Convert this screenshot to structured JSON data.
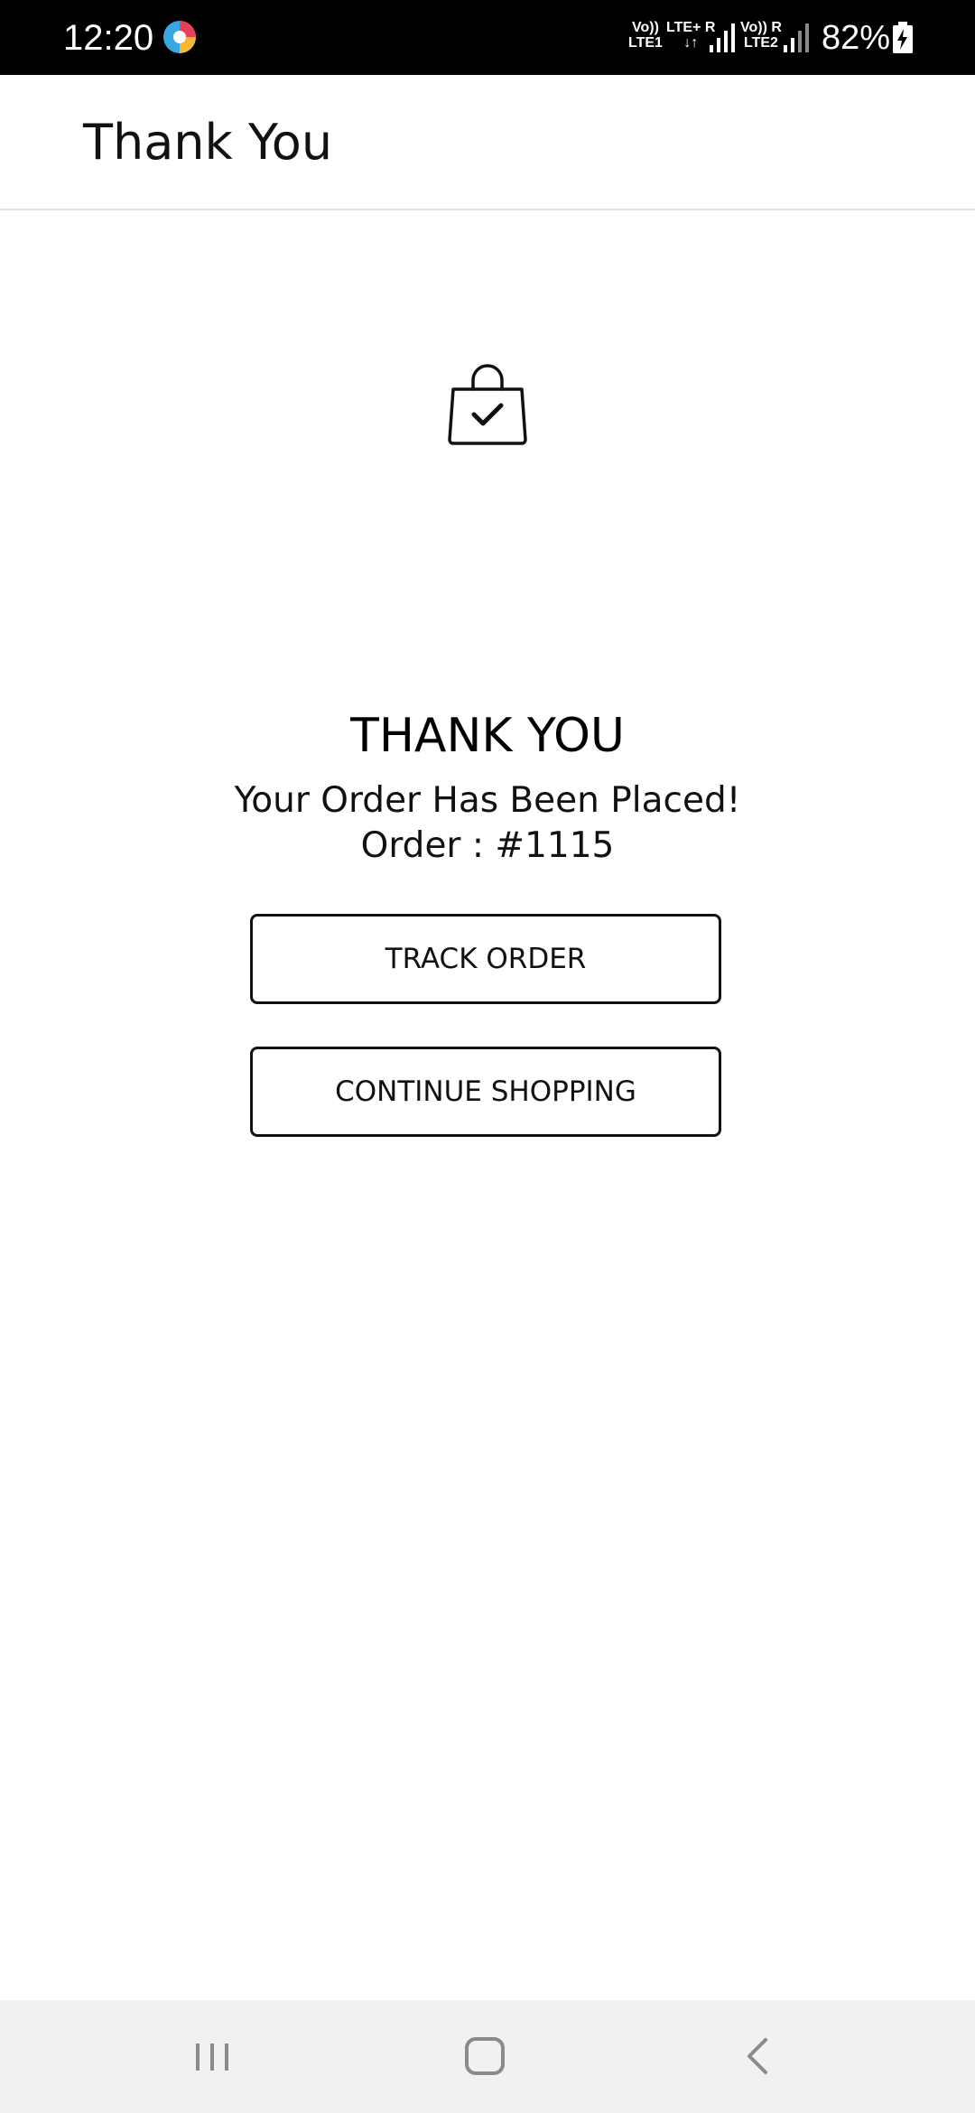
{
  "status_bar": {
    "time": "12:20",
    "sim1_top": "Vo))",
    "sim1_bottom": "LTE1",
    "sim1_net_top": "LTE+ R",
    "sim1_net_bottom": "↓↑",
    "sim2_top": "Vo)) R",
    "sim2_bottom": "LTE2",
    "battery": "82%"
  },
  "app_bar": {
    "title": "Thank You"
  },
  "confirmation": {
    "heading": "THANK YOU",
    "message": "Your Order Has Been Placed!",
    "order_label": "Order : #1115",
    "bag_icon": "shopping-bag-check-icon"
  },
  "actions": {
    "track_label": "TRACK ORDER",
    "continue_label": "CONTINUE SHOPPING"
  },
  "nav_bar": {
    "recents_icon": "recents-icon",
    "home_icon": "home-icon",
    "back_icon": "back-icon"
  },
  "colors": {
    "status_bar_bg": "#000000",
    "background": "#ffffff",
    "text": "#111111",
    "divider": "#e2e2e2",
    "nav_bar_bg": "#f1f1f1",
    "nav_icon": "#8a8a8a"
  }
}
